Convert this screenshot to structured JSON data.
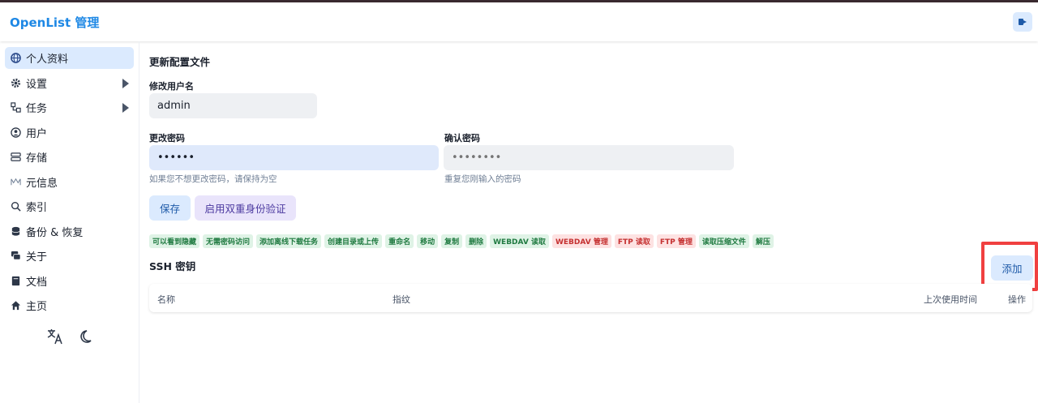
{
  "app": {
    "title": "OpenList 管理"
  },
  "header": {
    "logout_icon": "logout-icon"
  },
  "sidebar": {
    "items": [
      {
        "label": "个人资料",
        "icon": "globe-icon",
        "active": true
      },
      {
        "label": "设置",
        "icon": "gear-icon",
        "expandable": true
      },
      {
        "label": "任务",
        "icon": "workflow-icon",
        "expandable": true
      },
      {
        "label": "用户",
        "icon": "user-circle-icon"
      },
      {
        "label": "存储",
        "icon": "database-icon"
      },
      {
        "label": "元信息",
        "icon": "meta-icon"
      },
      {
        "label": "索引",
        "icon": "search-icon"
      },
      {
        "label": "备份 & 恢复",
        "icon": "stack-icon"
      },
      {
        "label": "关于",
        "icon": "chat-icon"
      },
      {
        "label": "文档",
        "icon": "book-icon"
      },
      {
        "label": "主页",
        "icon": "home-icon"
      }
    ],
    "bottom": {
      "language_icon": "translate-icon",
      "theme_icon": "moon-icon"
    }
  },
  "profile": {
    "section_title": "更新配置文件",
    "username": {
      "label": "修改用户名",
      "value": "admin"
    },
    "password": {
      "label": "更改密码",
      "value": "••••••",
      "helper": "如果您不想更改密码，请保持为空"
    },
    "confirm_password": {
      "label": "确认密码",
      "placeholder": "••••••••",
      "helper": "重复您刚输入的密码"
    },
    "save_label": "保存",
    "two_factor_label": "启用双重身份验证"
  },
  "permissions": [
    {
      "label": "可以看到隐藏",
      "granted": true
    },
    {
      "label": "无需密码访问",
      "granted": true
    },
    {
      "label": "添加离线下载任务",
      "granted": true
    },
    {
      "label": "创建目录或上传",
      "granted": true
    },
    {
      "label": "重命名",
      "granted": true
    },
    {
      "label": "移动",
      "granted": true
    },
    {
      "label": "复制",
      "granted": true
    },
    {
      "label": "删除",
      "granted": true
    },
    {
      "label": "WEBDAV 读取",
      "granted": true
    },
    {
      "label": "WEBDAV 管理",
      "granted": false
    },
    {
      "label": "FTP 读取",
      "granted": false
    },
    {
      "label": "FTP 管理",
      "granted": false
    },
    {
      "label": "读取压缩文件",
      "granted": true
    },
    {
      "label": "解压",
      "granted": true
    }
  ],
  "ssh": {
    "title": "SSH 密钥",
    "add_label": "添加",
    "columns": {
      "name": "名称",
      "fingerprint": "指纹",
      "last_used": "上次使用时间",
      "actions": "操作"
    }
  },
  "colors": {
    "accent": "#1e88e5",
    "active_bg": "#dbeafe",
    "granted_bg": "#dff3e6",
    "denied_bg": "#fde2e2",
    "highlight": "#f04040"
  }
}
